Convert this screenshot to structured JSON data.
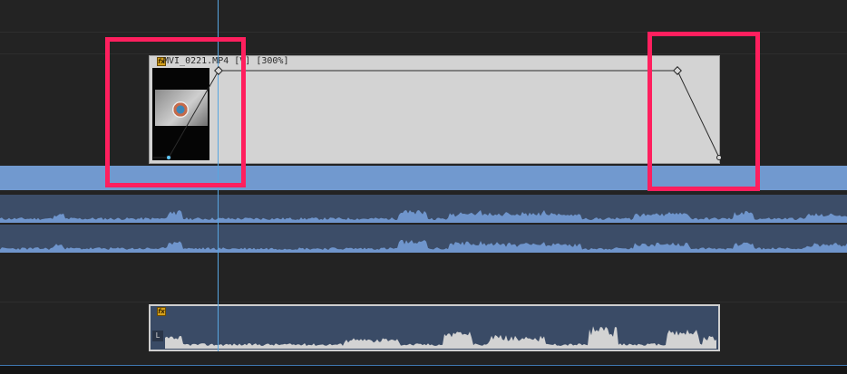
{
  "video_clip": {
    "fx_label": "fx",
    "name": "MVI_0221.MP4 [V] [300%]"
  },
  "audio_clip": {
    "fx_label": "fx",
    "channel_label": "L"
  },
  "colors": {
    "background": "#232323",
    "clip_fill": "#d3d3d3",
    "blue_bar": "#7199cf",
    "audio_lane": "#3c4d68",
    "waveform": "#6f95cc",
    "playhead": "#57a5e0",
    "highlight": "#ff1f5e",
    "fx_badge": "#d4a01c"
  }
}
